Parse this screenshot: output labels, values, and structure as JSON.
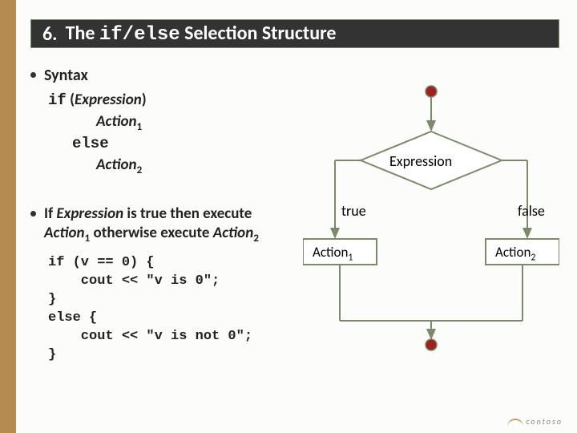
{
  "title": {
    "number": "6.",
    "prefix": "The ",
    "code": "if/else",
    "suffix": " Selection Structure"
  },
  "bullets": {
    "syntax_label": "Syntax",
    "syntax": {
      "if_kw": "if",
      "expr_paren_open": " (",
      "expr_word": "Expression",
      "expr_paren_close": ")",
      "action1_prefix": "Action",
      "action1_sub": "1",
      "else_kw": "else",
      "action2_prefix": "Action",
      "action2_sub": "2"
    },
    "desc": {
      "p1": "If ",
      "expr": "Expression",
      "p2": " is true then execute ",
      "a1": "Action",
      "a1s": "1",
      "p3": " otherwise execute ",
      "a2": "Action",
      "a2s": "2"
    },
    "code": "if (v == 0) {\n    cout << \"v is 0\";\n}\nelse {\n    cout << \"v is not 0\";\n}"
  },
  "flowchart": {
    "diamond_label": "Expression",
    "true_label": "true",
    "false_label": "false",
    "action1": "Action",
    "action1_sub": "1",
    "action2": "Action",
    "action2_sub": "2"
  },
  "logo_text": "contoso"
}
